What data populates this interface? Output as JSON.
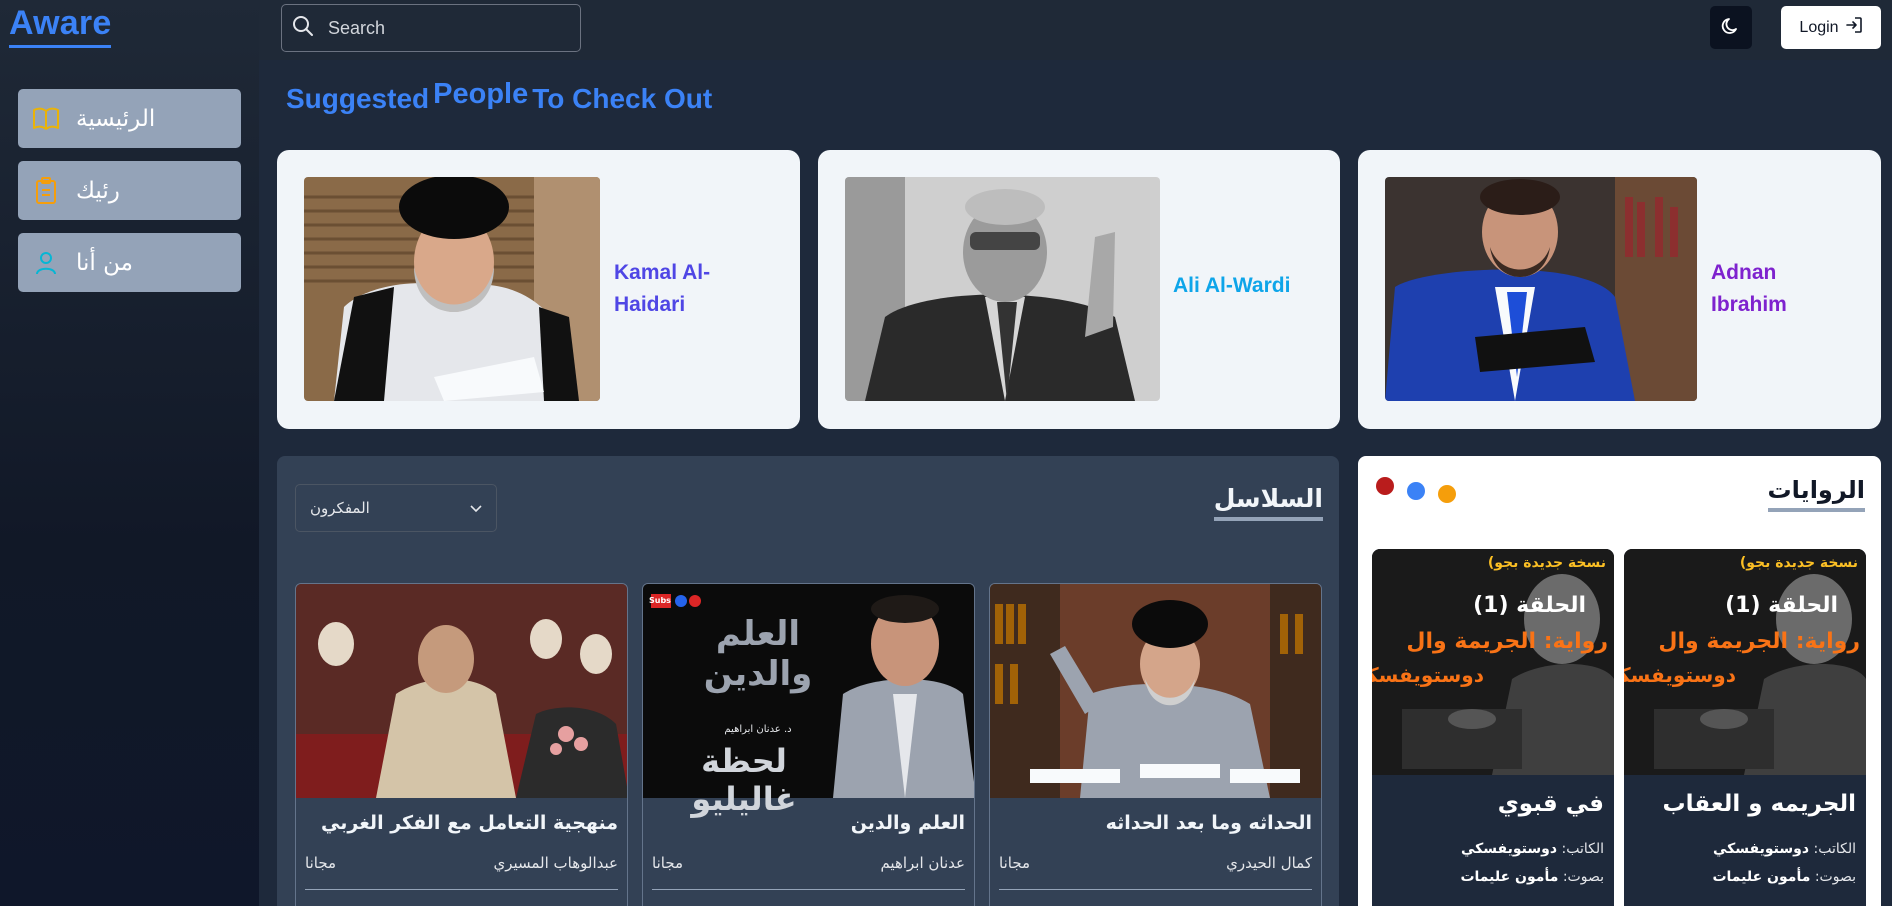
{
  "app": {
    "logo": "Aware"
  },
  "sidebar": {
    "items": [
      {
        "label": "الرئيسية",
        "icon": "book-open-icon",
        "color": "#eab308"
      },
      {
        "label": "رئيك",
        "icon": "clipboard-icon",
        "color": "#f59e0b"
      },
      {
        "label": "من أنا",
        "icon": "user-icon",
        "color": "#06b6d4"
      }
    ]
  },
  "topbar": {
    "search_placeholder": "Search",
    "theme_icon": "moon-icon",
    "login_label": "Login",
    "login_icon": "login-arrow-icon"
  },
  "suggested": {
    "heading_part1": "Suggested",
    "heading_part2": "People",
    "heading_part3": "To Check Out",
    "people": [
      {
        "name": "Kamal Al-Haidari",
        "color": "#4f46e5"
      },
      {
        "name": "Ali Al-Wardi",
        "color": "#0ea5e9"
      },
      {
        "name": "Adnan Ibrahim",
        "color": "#7e22ce"
      }
    ]
  },
  "series": {
    "title": "السلاسل",
    "filter_value": "المفكرون",
    "cards": [
      {
        "title": "منهجية التعامل مع الفكر الغربي",
        "author": "عبدالوهاب المسيري",
        "price": "مجانا"
      },
      {
        "title": "العلم والدين",
        "author": "عدنان ابراهيم",
        "price": "مجانا",
        "thumb_title": "العلم والدين",
        "thumb_sub": "لحظة غاليليو",
        "thumb_caption": "د. عدنان ابراهيم",
        "thumb_tag": "Subs"
      },
      {
        "title": "الحداثه وما بعد الحداثه",
        "author": "كمال الحيدري",
        "price": "مجانا"
      }
    ]
  },
  "novels": {
    "title": "الروايات",
    "dots": [
      "#b91c1c",
      "#3b82f6",
      "#f59e0b"
    ],
    "cards": [
      {
        "title": "في قبوي",
        "author_label": "الكاتب:",
        "author": "دوستويفسكي",
        "voice_label": "بصوت:",
        "voice": "مأمون عليمات",
        "thumb_top": "(نسخة جديدة بجو",
        "thumb_episode": "الحلقة (1)",
        "thumb_line1": "رواية: الجريمة وال",
        "thumb_line2": "دوستويفسكي"
      },
      {
        "title": "الجريمه و العقاب",
        "author_label": "الكاتب:",
        "author": "دوستويفسكي",
        "voice_label": "بصوت:",
        "voice": "مأمون عليمات",
        "thumb_top": "(نسخة جديدة بجو",
        "thumb_episode": "الحلقة (1)",
        "thumb_line1": "رواية: الجريمة وال",
        "thumb_line2": "دوستويفسكي"
      }
    ]
  }
}
